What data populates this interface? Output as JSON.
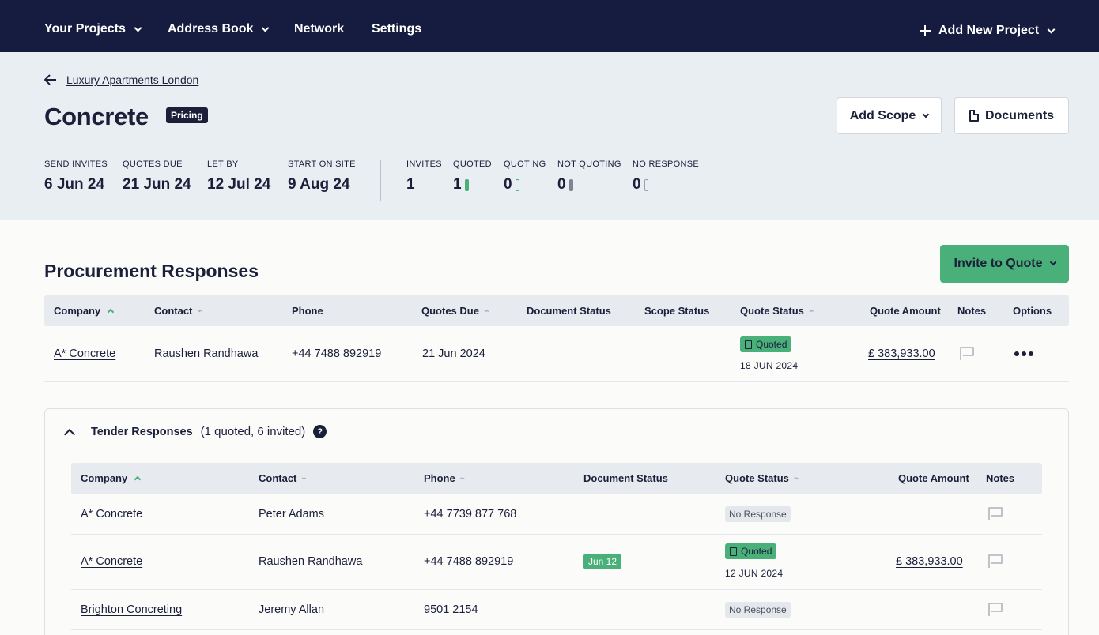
{
  "nav": {
    "projects": "Your Projects",
    "address_book": "Address Book",
    "network": "Network",
    "settings": "Settings",
    "add_project": "Add New Project"
  },
  "header": {
    "breadcrumb": "Luxury Apartments London",
    "title": "Concrete",
    "status_pill": "Pricing",
    "add_scope": "Add Scope",
    "documents": "Documents"
  },
  "dates": [
    {
      "label": "SEND INVITES",
      "value": "6 Jun 24"
    },
    {
      "label": "QUOTES DUE",
      "value": "21 Jun 24"
    },
    {
      "label": "LET BY",
      "value": "12 Jul 24"
    },
    {
      "label": "START ON SITE",
      "value": "9 Aug 24"
    }
  ],
  "counts": [
    {
      "label": "INVITES",
      "value": "1"
    },
    {
      "label": "QUOTED",
      "value": "1"
    },
    {
      "label": "QUOTING",
      "value": "0"
    },
    {
      "label": "NOT QUOTING",
      "value": "0"
    },
    {
      "label": "NO RESPONSE",
      "value": "0"
    }
  ],
  "colors": {
    "accent_green": "#4ab07a",
    "nav_bg": "#161c3f",
    "header_bg": "#e8eef2"
  },
  "procurement": {
    "title": "Procurement Responses",
    "invite_button": "Invite to Quote",
    "columns": [
      "Company",
      "Contact",
      "Phone",
      "Quotes Due",
      "Document Status",
      "Scope Status",
      "Quote Status",
      "Quote Amount",
      "Notes",
      "Options"
    ],
    "rows": [
      {
        "company": "A* Concrete",
        "contact": "Raushen Randhawa",
        "phone": "+44 7488 892919",
        "quotes_due": "21 Jun 2024",
        "quote_status": "Quoted",
        "quote_date": "18 JUN 2024",
        "amount": "£ 383,933.00"
      }
    ]
  },
  "tender": {
    "title": "Tender Responses",
    "summary": "(1 quoted, 6 invited)",
    "help": "?",
    "columns": [
      "Company",
      "Contact",
      "Phone",
      "Document Status",
      "Quote Status",
      "Quote Amount",
      "Notes"
    ],
    "rows": [
      {
        "company": "A* Concrete",
        "contact": "Peter Adams",
        "phone": "+44 7739 877 768",
        "doc_status": "",
        "quote_status": "No Response",
        "quote_date": "",
        "amount": ""
      },
      {
        "company": "A* Concrete",
        "contact": "Raushen Randhawa",
        "phone": "+44 7488 892919",
        "doc_status": "Jun 12",
        "quote_status": "Quoted",
        "quote_date": "12 JUN 2024",
        "amount": "£ 383,933.00"
      },
      {
        "company": "Brighton Concreting",
        "contact": "Jeremy Allan",
        "phone": "9501 2154",
        "doc_status": "",
        "quote_status": "No Response",
        "quote_date": "",
        "amount": ""
      }
    ]
  }
}
